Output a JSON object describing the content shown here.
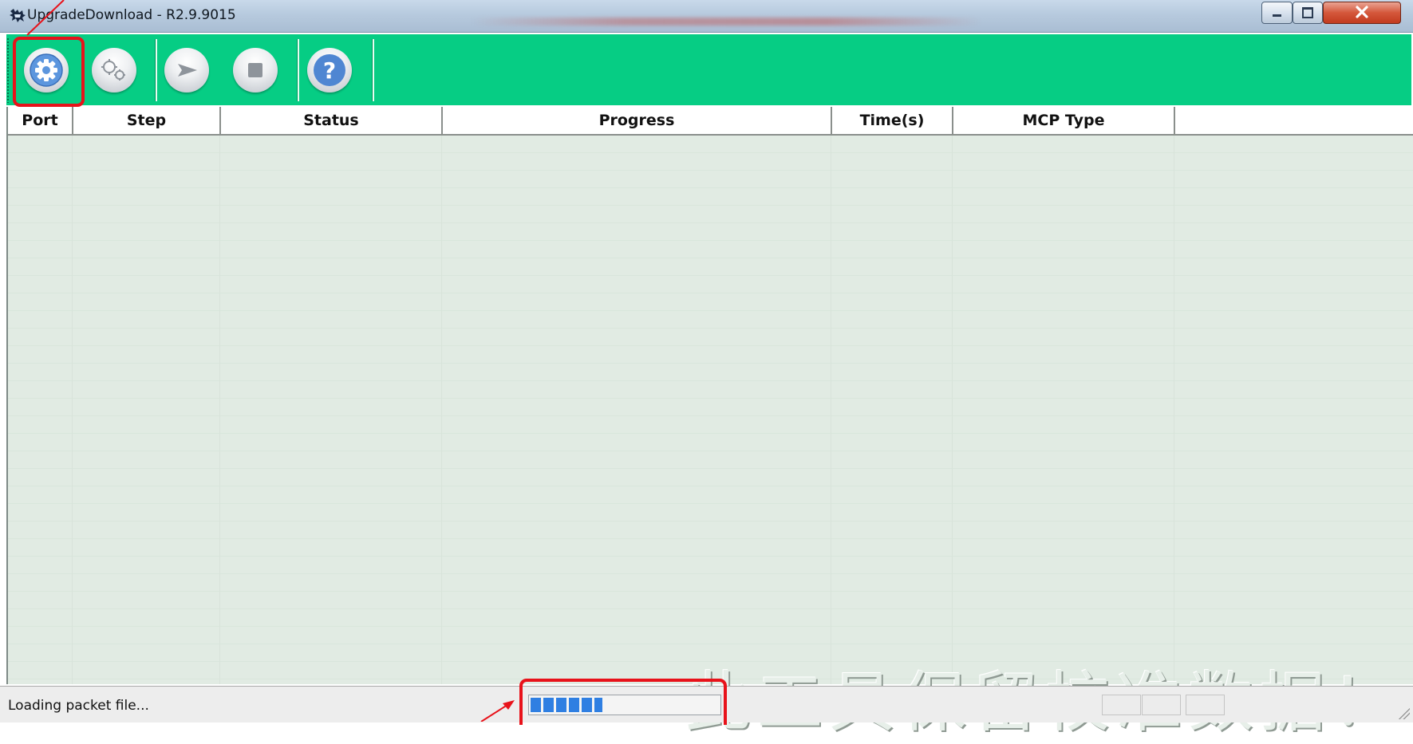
{
  "window": {
    "title": "UpgradeDownload - R2.9.9015",
    "app_icon": "app-logo-icon",
    "controls": [
      "minimize-icon",
      "maximize-icon",
      "close-icon"
    ]
  },
  "toolbar": {
    "buttons": [
      {
        "icon": "gear-icon",
        "highlighted": true
      },
      {
        "icon": "gears-icon"
      },
      {
        "icon": "play-arrow-icon"
      },
      {
        "icon": "stop-icon"
      },
      {
        "icon": "help-icon"
      }
    ]
  },
  "table": {
    "columns": [
      "Port",
      "Step",
      "Status",
      "Progress",
      "Time(s)",
      "MCP Type",
      ""
    ],
    "rows": []
  },
  "watermark": "此工具保留校准数据！",
  "statusbar": {
    "message": "Loading packet file...",
    "progress_fraction": 0.38,
    "progress_highlighted": true
  },
  "colors": {
    "toolbar": "#06cd84",
    "highlight": "#e8121a",
    "progress": "#2f7fe2",
    "grid_bg": "#e1ebe3"
  }
}
